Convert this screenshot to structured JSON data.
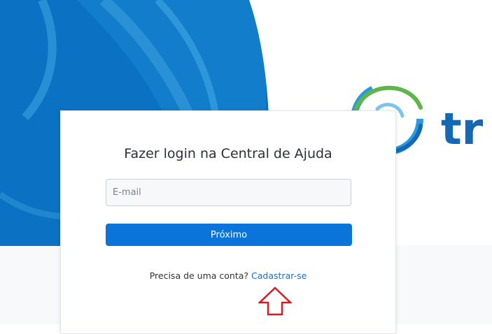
{
  "login": {
    "title": "Fazer login na Central de Ajuda",
    "email_placeholder": "E-mail",
    "email_value": "",
    "next_label": "Próximo",
    "signup_prompt": "Precisa de uma conta?",
    "signup_link": "Cadastrar-se"
  },
  "brand": {
    "logo_text": "tr",
    "logo_icon": "swirl-globe-icon"
  },
  "annotation": {
    "pointer_icon": "up-arrow-outline-icon"
  },
  "colors": {
    "hero_blue": "#0b72c3",
    "hero_blue_light": "#2c96d8",
    "button_blue": "#0a74db",
    "link_blue": "#1a6fc7",
    "logo_text_blue": "#1668b3",
    "logo_green": "#5db54b",
    "arrow_red": "#d71920"
  }
}
